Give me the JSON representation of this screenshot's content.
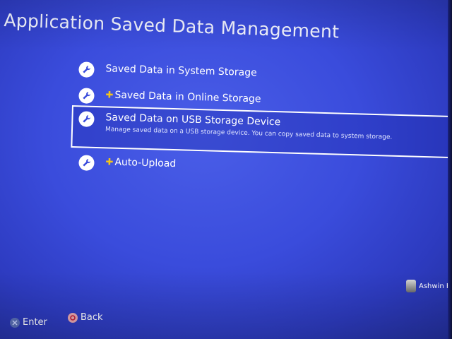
{
  "header": {
    "title": "Application Saved Data Management"
  },
  "menu": {
    "items": [
      {
        "label": "Saved Data in System Storage",
        "icon": "wrench-icon",
        "ps_plus": false
      },
      {
        "label": "Saved Data in Online Storage",
        "icon": "wrench-icon",
        "ps_plus": true
      },
      {
        "label": "Saved Data on USB Storage Device",
        "icon": "wrench-icon",
        "ps_plus": false,
        "selected": true,
        "description": "Manage saved data on a USB storage device. You can copy saved data to system storage."
      },
      {
        "label": "Auto-Upload",
        "icon": "wrench-icon",
        "ps_plus": true
      }
    ]
  },
  "user": {
    "name": "Ashwin Ka"
  },
  "footer": {
    "enter_label": "Enter",
    "back_label": "Back"
  },
  "colors": {
    "background": "#3a4cdc",
    "text": "#ffffff",
    "ps_plus": "#f5c518"
  }
}
